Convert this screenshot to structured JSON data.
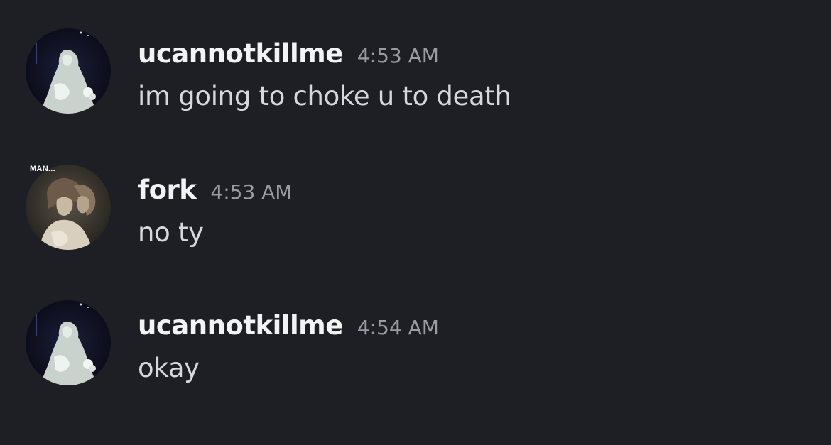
{
  "messages": [
    {
      "username": "ucannotkillme",
      "timestamp": "4:53 AM",
      "text": "im going to choke u to death",
      "avatar_icon": "statue-avatar"
    },
    {
      "username": "fork",
      "timestamp": "4:53 AM",
      "text": "no ty",
      "avatar_icon": "anime-avatar",
      "avatar_caption": "MAN..."
    },
    {
      "username": "ucannotkillme",
      "timestamp": "4:54 AM",
      "text": "okay",
      "avatar_icon": "statue-avatar"
    }
  ],
  "colors": {
    "background": "#1e1f24",
    "username": "#f2f3f5",
    "timestamp": "#9a9ca4",
    "message_text": "#d6d8dc"
  }
}
